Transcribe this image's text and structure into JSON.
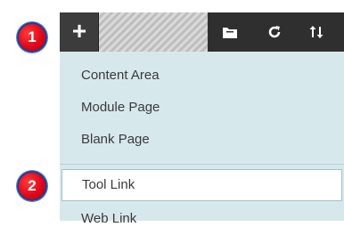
{
  "badges": {
    "step1": "1",
    "step2": "2"
  },
  "toolbar": {
    "add_icon": "plus-icon",
    "add_glyph": "+",
    "icons": [
      "folder-icon",
      "refresh-icon",
      "sort-icon"
    ]
  },
  "menu": {
    "items": [
      {
        "label": "Content Area"
      },
      {
        "label": "Module Page"
      },
      {
        "label": "Blank Page"
      },
      {
        "label": "Tool Link"
      },
      {
        "label": "Web Link"
      }
    ]
  },
  "colors": {
    "badge_red": "#e0081a",
    "toolbar_bg": "#2f2f2f",
    "menu_bg": "#d7e8ec",
    "highlight_bg": "#ffffff"
  }
}
